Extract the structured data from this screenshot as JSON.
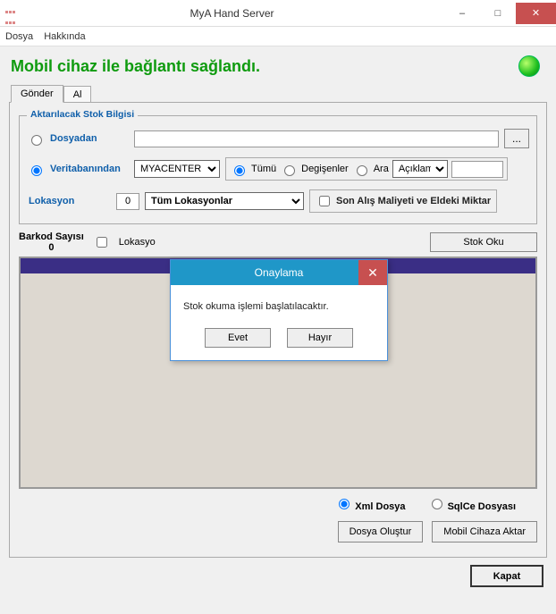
{
  "window": {
    "title": "MyA Hand Server",
    "minimize": "–",
    "maximize": "□",
    "close": "✕"
  },
  "menu": {
    "file": "Dosya",
    "about": "Hakkında"
  },
  "status_text": "Mobil cihaz ile bağlantı sağlandı.",
  "tabs": {
    "send": "Gönder",
    "receive": "Al"
  },
  "stock_group": {
    "title": "Aktarılacak Stok Bilgisi",
    "from_file_label": "Dosyadan",
    "from_file_value": "",
    "browse_label": "...",
    "from_db_label": "Veritabanından",
    "db_options": [
      "MYACENTER"
    ],
    "db_selected": "MYACENTER",
    "filter_all": "Tümü",
    "filter_changed": "Degişenler",
    "filter_search": "Ara",
    "search_field_options": [
      "Açıklama"
    ],
    "search_field_selected": "Açıklama",
    "search_value": "",
    "location_label": "Lokasyon",
    "location_code": "0",
    "location_options": [
      "Tüm Lokasyonlar"
    ],
    "location_selected": "Tüm Lokasyonlar",
    "last_cost_chk": "Son Alış Maliyeti ve Eldeki Miktar"
  },
  "barkod": {
    "label": "Barkod Sayısı",
    "count": "0",
    "lokasyon_chk": "Lokasyo",
    "read_btn": "Stok Oku"
  },
  "output": {
    "xml_label": "Xml Dosya",
    "sqlce_label": "SqlCe Dosyası"
  },
  "actions": {
    "create_file": "Dosya Oluştur",
    "send_device": "Mobil Cihaza Aktar",
    "close": "Kapat"
  },
  "dialog": {
    "title": "Onaylama",
    "message": "Stok okuma işlemi başlatılacaktır.",
    "yes": "Evet",
    "no": "Hayır",
    "close": "✕"
  }
}
